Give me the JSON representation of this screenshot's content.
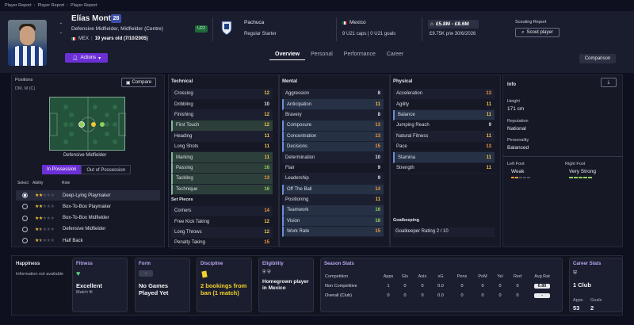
{
  "breadcrumbs": [
    "Player Report",
    "Player Report",
    "Player Report"
  ],
  "player": {
    "name": "Elías Montiel",
    "number": "28",
    "positions": "Defensive Midfielder, Midfielder (Centre)",
    "nation_code": "MEX",
    "age_text": "19 years old (7/10/2005)",
    "u22": "U22",
    "club": "Pachuca",
    "club_role": "Regular Starter",
    "nation": "Mexico",
    "caps": "9 U21 caps | 0 U21 goals",
    "value": "£5.8M - £8.6M",
    "wage": "£9.75K p/w  30/6/2026"
  },
  "header": {
    "actions_label": "Actions",
    "scout_report_label": "Scouting Report",
    "scout_player_label": "Scout player",
    "comparison_label": "Comparison",
    "tabs": [
      {
        "label": "Overview",
        "active": true
      },
      {
        "label": "Personal",
        "active": false
      },
      {
        "label": "Performance",
        "active": false
      },
      {
        "label": "Career",
        "active": false
      }
    ]
  },
  "positions_panel": {
    "title": "Positions",
    "value": "DM, M (C)",
    "compare_label": "Compare",
    "role_label": "Defensive Midfielder",
    "in_possession": "In Possession",
    "out_possession": "Out of Possession",
    "col_select": "Select",
    "col_ability": "Ability",
    "col_role": "Role",
    "roles": [
      {
        "name": "Deep-Lying Playmaker",
        "stars": 2,
        "selected": true
      },
      {
        "name": "Box-To-Box Playmaker",
        "stars": 2,
        "selected": false
      },
      {
        "name": "Box-To-Box Midfielder",
        "stars": 2,
        "selected": false
      },
      {
        "name": "Defensive Midfielder",
        "stars": 1.5,
        "selected": false
      },
      {
        "name": "Half Back",
        "stars": 1.5,
        "selected": false
      }
    ]
  },
  "technical": {
    "title": "Technical",
    "rows": [
      {
        "name": "Crossing",
        "value": "12",
        "style": "alt"
      },
      {
        "name": "Dribbling",
        "value": "10",
        "style": ""
      },
      {
        "name": "Finishing",
        "value": "12",
        "style": "alt"
      },
      {
        "name": "First Touch",
        "value": "12",
        "style": "hl"
      },
      {
        "name": "Heading",
        "value": "11",
        "style": "alt"
      },
      {
        "name": "Long Shots",
        "value": "11",
        "style": ""
      },
      {
        "name": "Marking",
        "value": "11",
        "style": "hl"
      },
      {
        "name": "Passing",
        "value": "16",
        "style": "hl"
      },
      {
        "name": "Tackling",
        "value": "13",
        "style": "hl"
      },
      {
        "name": "Technique",
        "value": "16",
        "style": "hl"
      }
    ]
  },
  "set_pieces": {
    "title": "Set Pieces",
    "rows": [
      {
        "name": "Corners",
        "value": "14",
        "style": "alt"
      },
      {
        "name": "Free Kick Taking",
        "value": "12",
        "style": ""
      },
      {
        "name": "Long Throws",
        "value": "12",
        "style": "alt"
      },
      {
        "name": "Penalty Taking",
        "value": "15",
        "style": ""
      }
    ]
  },
  "mental": {
    "title": "Mental",
    "rows": [
      {
        "name": "Aggression",
        "value": "8",
        "style": "alt"
      },
      {
        "name": "Anticipation",
        "value": "11",
        "style": "hl2"
      },
      {
        "name": "Bravery",
        "value": "8",
        "style": "alt"
      },
      {
        "name": "Composure",
        "value": "13",
        "style": "hl2"
      },
      {
        "name": "Concentration",
        "value": "13",
        "style": "hl2"
      },
      {
        "name": "Decisions",
        "value": "15",
        "style": "hl2"
      },
      {
        "name": "Determination",
        "value": "10",
        "style": "alt"
      },
      {
        "name": "Flair",
        "value": "9",
        "style": ""
      },
      {
        "name": "Leadership",
        "value": "9",
        "style": "alt"
      },
      {
        "name": "Off The Ball",
        "value": "14",
        "style": "hl2"
      },
      {
        "name": "Positioning",
        "value": "11",
        "style": "alt"
      },
      {
        "name": "Teamwork",
        "value": "16",
        "style": "hl2"
      },
      {
        "name": "Vision",
        "value": "18",
        "style": "hl2"
      },
      {
        "name": "Work Rate",
        "value": "15",
        "style": "hl2"
      }
    ]
  },
  "physical": {
    "title": "Physical",
    "rows": [
      {
        "name": "Acceleration",
        "value": "13",
        "style": "alt"
      },
      {
        "name": "Agility",
        "value": "11",
        "style": ""
      },
      {
        "name": "Balance",
        "value": "11",
        "style": "hl2"
      },
      {
        "name": "Jumping Reach",
        "value": "9",
        "style": ""
      },
      {
        "name": "Natural Fitness",
        "value": "11",
        "style": "alt"
      },
      {
        "name": "Pace",
        "value": "13",
        "style": ""
      },
      {
        "name": "Stamina",
        "value": "11",
        "style": "hl2"
      },
      {
        "name": "Strength",
        "value": "11",
        "style": ""
      }
    ]
  },
  "goalkeeping": {
    "title": "Goalkeeping",
    "label": "Goalkeeper Rating",
    "value": "2 / 10"
  },
  "info": {
    "title": "Info",
    "height_label": "Height",
    "height": "171 cm",
    "reputation_label": "Reputation",
    "reputation": "National",
    "personality_label": "Personality",
    "personality": "Balanced",
    "left_foot_label": "Left Foot",
    "left_foot": "Weak",
    "right_foot_label": "Right Foot",
    "right_foot": "Very Strong"
  },
  "happiness": {
    "title": "Happiness",
    "text": "Information not available"
  },
  "fitness": {
    "title": "Fitness",
    "value": "Excellent",
    "sub": "Match fit"
  },
  "form": {
    "title": "Form",
    "badge": "-",
    "value": "No Games Played Yet"
  },
  "discipline": {
    "title": "Discipline",
    "value": "2 bookings from ban (1 match)"
  },
  "eligibility": {
    "title": "Eligibility",
    "value": "Homegrown player in Mexico"
  },
  "season_stats": {
    "title": "Season Stats",
    "headers": [
      "Competition",
      "Apps",
      "Gls",
      "Asts",
      "xG",
      "Pens",
      "PoM",
      "Yel",
      "Red",
      "Avg Rat"
    ],
    "rows": [
      [
        "Non Competitive",
        "1",
        "0",
        "0",
        "0.0",
        "0",
        "0",
        "0",
        "0",
        "6.80"
      ],
      [
        "Overall (Club)",
        "0",
        "0",
        "0",
        "0.0",
        "0",
        "0",
        "0",
        "0",
        "-"
      ]
    ]
  },
  "career_stats": {
    "title": "Career Stats",
    "clubs": "1 Club",
    "apps_label": "Apps",
    "goals_label": "Goals",
    "apps": "53",
    "goals": "2"
  }
}
